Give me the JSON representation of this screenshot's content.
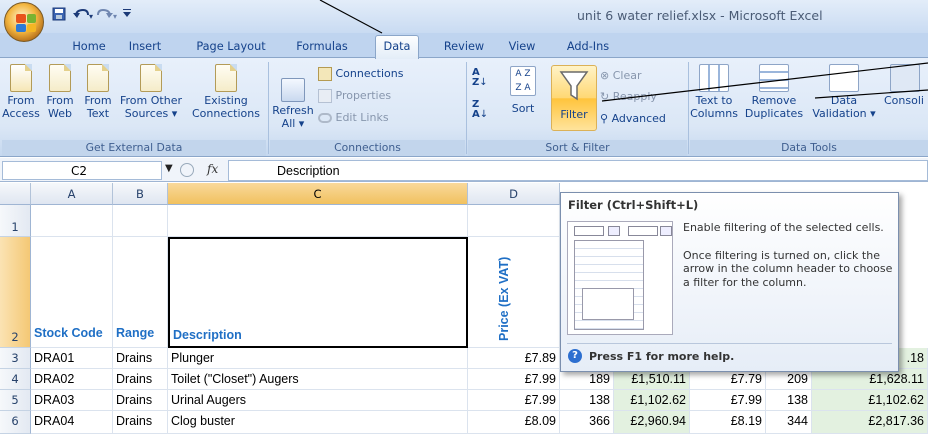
{
  "window": {
    "title": "unit 6 water relief.xlsx - Microsoft Excel"
  },
  "ribbon_tabs": [
    "Home",
    "Insert",
    "Page Layout",
    "Formulas",
    "Data",
    "Review",
    "View",
    "Add-Ins"
  ],
  "active_tab": "Data",
  "groups": {
    "external": {
      "label": "Get External Data",
      "buttons": [
        {
          "line1": "From",
          "line2": "Access"
        },
        {
          "line1": "From",
          "line2": "Web"
        },
        {
          "line1": "From",
          "line2": "Text"
        },
        {
          "line1": "From Other",
          "line2": "Sources ▾"
        },
        {
          "line1": "Existing",
          "line2": "Connections"
        }
      ]
    },
    "connections": {
      "label": "Connections",
      "refresh_line1": "Refresh",
      "refresh_line2": "All ▾",
      "connections": "Connections",
      "properties": "Properties",
      "edit_links": "Edit Links"
    },
    "sort_filter": {
      "label": "Sort & Filter",
      "sort": "Sort",
      "filter": "Filter",
      "clear": "Clear",
      "reapply": "Reapply",
      "advanced": "Advanced"
    },
    "data_tools": {
      "label": "Data Tools",
      "buttons": [
        {
          "line1": "Text to",
          "line2": "Columns"
        },
        {
          "line1": "Remove",
          "line2": "Duplicates"
        },
        {
          "line1": "Data",
          "line2": "Validation ▾"
        },
        {
          "line1": "Consoli",
          "line2": ""
        }
      ]
    }
  },
  "formula_bar": {
    "name_box": "C2",
    "fx": "fx",
    "value": "Description"
  },
  "columns": [
    "A",
    "B",
    "C",
    "D"
  ],
  "rows": [
    {
      "num": "1",
      "cells": [
        "",
        "",
        "",
        ""
      ]
    },
    {
      "num": "2",
      "cells": [
        "Stock Code",
        "Range",
        "Description",
        "Price (Ex VAT)"
      ]
    },
    {
      "num": "3",
      "cells": [
        "DRA01",
        "Drains",
        "Plunger",
        "£7.89",
        "",
        "",
        "",
        "",
        ".18"
      ]
    },
    {
      "num": "4",
      "cells": [
        "DRA02",
        "Drains",
        "Toilet (\"Closet\") Augers",
        "£7.99",
        "189",
        "£1,510.11",
        "£7.79",
        "209",
        "£1,628.11"
      ]
    },
    {
      "num": "5",
      "cells": [
        "DRA03",
        "Drains",
        "Urinal Augers",
        "£7.99",
        "138",
        "£1,102.62",
        "£7.99",
        "138",
        "£1,102.62"
      ]
    },
    {
      "num": "6",
      "cells": [
        "DRA04",
        "Drains",
        "Clog buster",
        "£8.09",
        "366",
        "£2,960.94",
        "£8.19",
        "344",
        "£2,817.36"
      ]
    }
  ],
  "tooltip": {
    "title": "Filter (Ctrl+Shift+L)",
    "para1": "Enable filtering of the selected cells.",
    "para2": "Once filtering is turned on, click the arrow in the column header to choose a filter for the column.",
    "help": "Press F1 for more help.",
    "help_icon": "?"
  },
  "icons": [
    "office-button-icon",
    "save-icon",
    "undo-icon",
    "redo-icon",
    "filter-funnel-icon",
    "sort-az-icon",
    "help-icon"
  ]
}
